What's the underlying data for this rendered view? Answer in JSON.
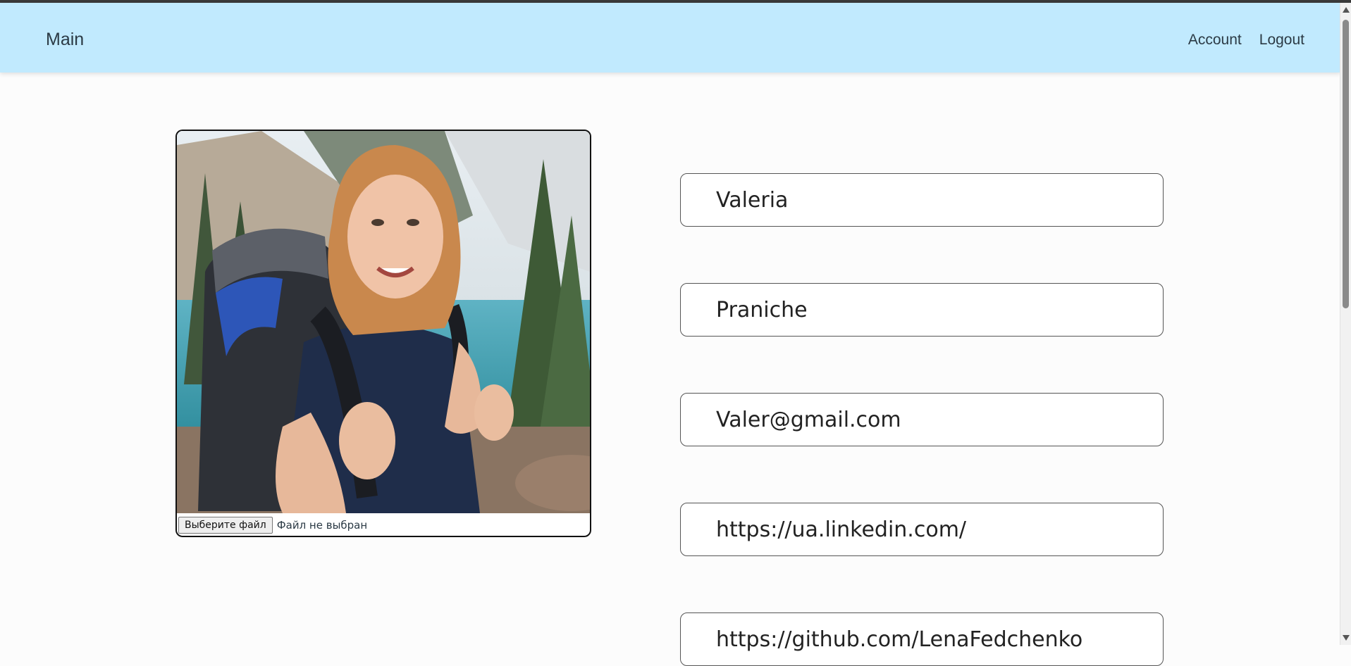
{
  "navbar": {
    "brand": "Main",
    "links": [
      "Account",
      "Logout"
    ],
    "background": "#c1eafe"
  },
  "profile": {
    "photo_alt": "profile photo",
    "file_button_label": "Выберите файл",
    "file_status": "Файл не выбран"
  },
  "form": {
    "first_name": "Valeria",
    "last_name": "Praniche",
    "email": "Valer@gmail.com",
    "linkedin": "https://ua.linkedin.com/",
    "github": "https://github.com/LenaFedchenko"
  }
}
